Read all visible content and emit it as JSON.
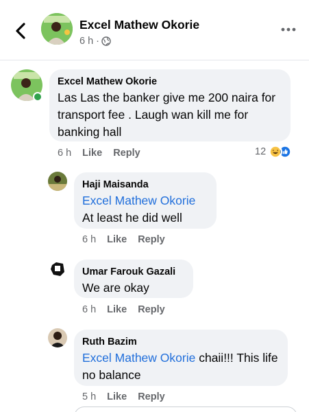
{
  "header": {
    "name": "Excel Mathew Okorie",
    "time": "6 h ·",
    "back_icon": "chevron-left-icon",
    "privacy_icon": "globe-icon",
    "more_icon": "more-horizontal-icon"
  },
  "comments": [
    {
      "author": "Excel Mathew Okorie",
      "text": "Las Las the banker give me 200 naira for transport fee . Laugh wan kill me for banking hall",
      "time": "6 h",
      "like": "Like",
      "reply": "Reply",
      "reaction_count": "12",
      "reaction_icons": [
        "haha-icon",
        "like-icon"
      ]
    },
    {
      "author": "Haji Maisanda",
      "mention": "Excel Mathew Okorie",
      "text": "At least he did well",
      "time": "6 h",
      "like": "Like",
      "reply": "Reply"
    },
    {
      "author": "Umar Farouk Gazali",
      "text": "We are okay",
      "time": "6 h",
      "like": "Like",
      "reply": "Reply"
    },
    {
      "author": "Ruth Bazim",
      "mention": "Excel Mathew Okorie",
      "text": " chaii!!! This life no balance",
      "time": "5 h",
      "like": "Like",
      "reply": "Reply"
    }
  ],
  "colors": {
    "bubble": "#f0f2f5",
    "mention": "#216fdb",
    "meta": "#65676b",
    "online": "#31a24c"
  }
}
